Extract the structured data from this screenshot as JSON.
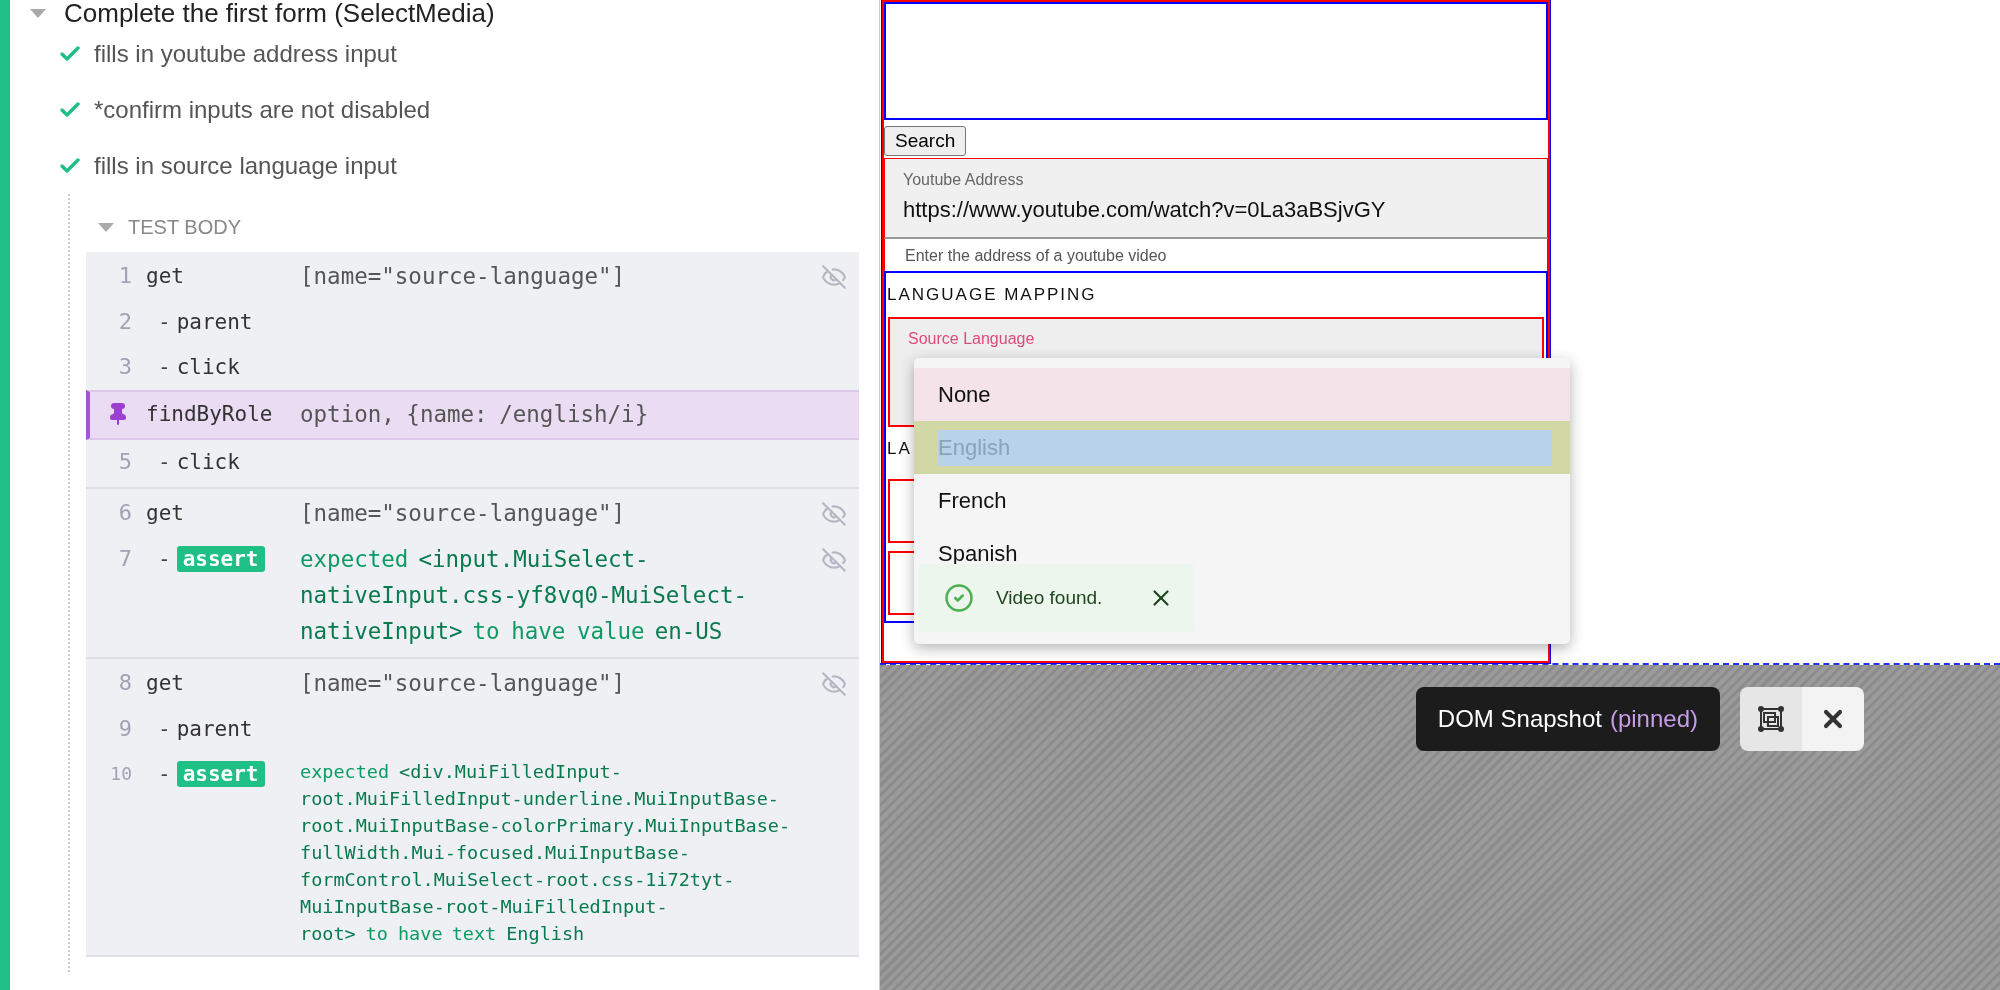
{
  "suite": {
    "title": "Complete the first form (SelectMedia)",
    "expanded": true
  },
  "tests": [
    {
      "title": "fills in youtube address input",
      "passed": true
    },
    {
      "title": "*confirm inputs are not disabled",
      "passed": true
    },
    {
      "title": "fills in source language input",
      "passed": true
    }
  ],
  "test_body": {
    "label": "TEST BODY",
    "expanded": true,
    "groups": [
      {
        "commands": [
          {
            "kind": "command",
            "number": "1",
            "name": "get",
            "message": [
              {
                "text": "[name=\"source-language\"]",
                "emphasis": false
              }
            ],
            "visibility_toggle": true
          },
          {
            "kind": "child",
            "number": "2",
            "prefix": "-",
            "name": "parent",
            "visibility_toggle": false
          },
          {
            "kind": "child",
            "number": "3",
            "prefix": "-",
            "name": "click",
            "visibility_toggle": false
          },
          {
            "kind": "pinned",
            "name": "findByRole",
            "message": [
              {
                "text": "option, {name: /english/i}",
                "emphasis": false
              }
            ],
            "visibility_toggle": false
          },
          {
            "kind": "child",
            "number": "5",
            "prefix": "-",
            "name": "click",
            "visibility_toggle": false
          }
        ]
      },
      {
        "commands": [
          {
            "kind": "command",
            "number": "6",
            "name": "get",
            "message": [
              {
                "text": "[name=\"source-language\"]",
                "emphasis": false
              }
            ],
            "visibility_toggle": true
          },
          {
            "kind": "assert",
            "number": "7",
            "prefix": "-",
            "name": "assert",
            "compact": false,
            "message": [
              {
                "text": "expected",
                "emphasis": false
              },
              {
                "text": "<input.MuiSelect-nativeInput.css-yf8vq0-MuiSelect-nativeInput>",
                "emphasis": true
              },
              {
                "text": "to have value",
                "emphasis": false
              },
              {
                "text": "en-US",
                "emphasis": true
              }
            ],
            "visibility_toggle": true
          }
        ]
      },
      {
        "commands": [
          {
            "kind": "command",
            "number": "8",
            "name": "get",
            "message": [
              {
                "text": "[name=\"source-language\"]",
                "emphasis": false
              }
            ],
            "visibility_toggle": true
          },
          {
            "kind": "child",
            "number": "9",
            "prefix": "-",
            "name": "parent",
            "visibility_toggle": false
          },
          {
            "kind": "assert",
            "number": "10",
            "prefix": "-",
            "name": "assert",
            "compact": true,
            "message": [
              {
                "text": "expected",
                "emphasis": false
              },
              {
                "text": "<div.MuiFilledInput-root.MuiFilledInput-underline.MuiInputBase-root.MuiInputBase-colorPrimary.MuiInputBase-fullWidth.Mui-focused.MuiInputBase-formControl.MuiSelect-root.css-1i72tyt-MuiInputBase-root-MuiFilledInput-root>",
                "emphasis": true
              },
              {
                "text": "to",
                "emphasis": false
              },
              {
                "text": "have text",
                "emphasis": false
              },
              {
                "text": "English",
                "emphasis": true
              }
            ],
            "visibility_toggle": false
          }
        ]
      }
    ]
  },
  "app": {
    "search_button": "Search",
    "youtube_field": {
      "label": "Youtube Address",
      "value": "https://www.youtube.com/watch?v=0La3aBSjvGY"
    },
    "helper_text": "Enter the address of a youtube video",
    "section_heading": "LANGUAGE MAPPING",
    "source_language_field": {
      "label": "Source Language"
    },
    "second_heading": "LA"
  },
  "dropdown": {
    "options": [
      {
        "label": "None",
        "hovered": true,
        "selected": false
      },
      {
        "label": "English",
        "hovered": false,
        "selected": true
      },
      {
        "label": "French",
        "hovered": false,
        "selected": false
      },
      {
        "label": "Spanish",
        "hovered": false,
        "selected": false
      }
    ]
  },
  "snackbar": {
    "message": "Video found."
  },
  "snapshot_bar": {
    "title": "DOM Snapshot",
    "status": "(pinned)"
  }
}
